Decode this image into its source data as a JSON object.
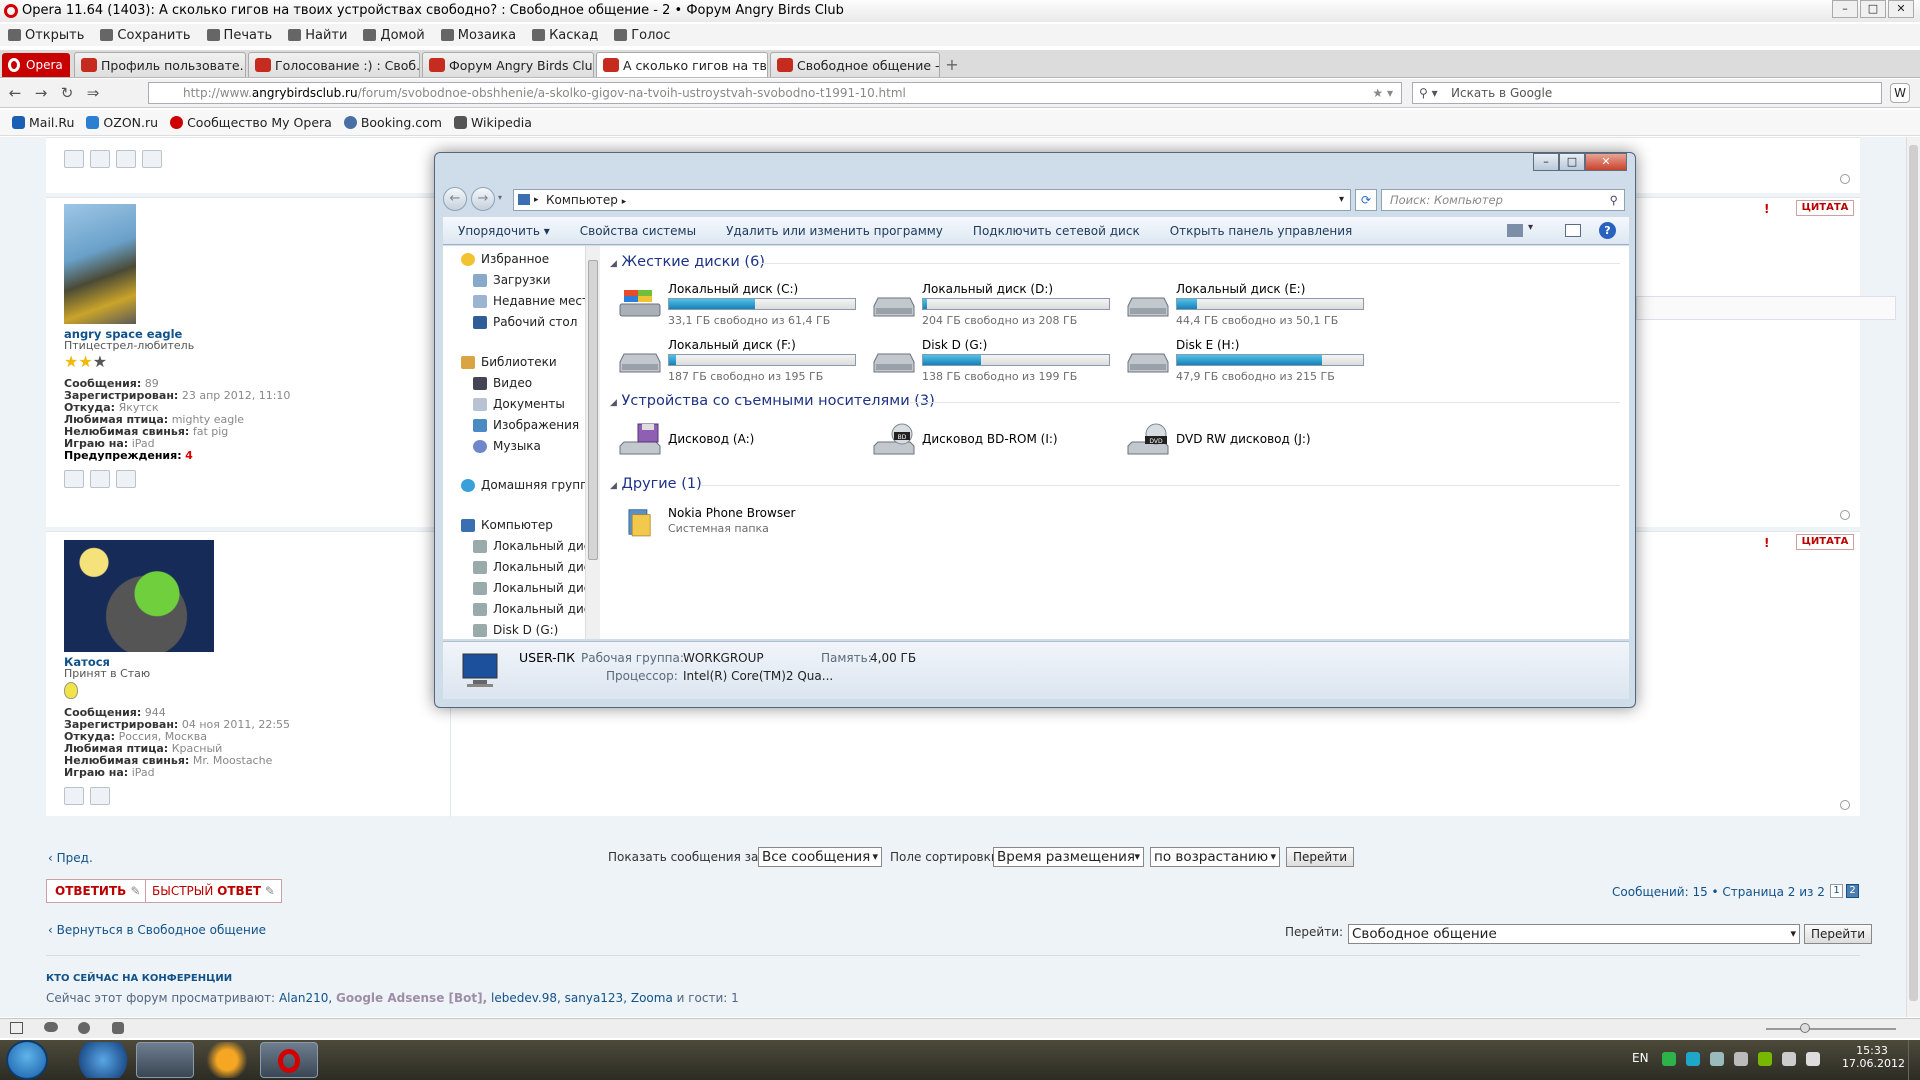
{
  "browser": {
    "title": "Opera 11.64 (1403): А сколько гигов на твоих устройствах свободно? : Свободное общение - 2 • Форум Angry Birds Club",
    "menu": [
      "Открыть",
      "Сохранить",
      "Печать",
      "Найти",
      "Домой",
      "Мозаика",
      "Каскад",
      "Голос"
    ],
    "opera_label": "Opera",
    "tabs": [
      {
        "label": "Профиль пользовате...",
        "active": false
      },
      {
        "label": "Голосование :) : Своб...",
        "active": false
      },
      {
        "label": "Форум Angry Birds Clu...",
        "active": false
      },
      {
        "label": "А сколько гигов на тв...",
        "active": true
      },
      {
        "label": "Свободное общение -...",
        "active": false
      }
    ],
    "address_prefix": "http://www.",
    "address_host": "angrybirdsclub.ru",
    "address_path": "/forum/svobodnoe-obshhenie/a-skolko-gigov-na-tvoih-ustroystvah-svobodno-t1991-10.html",
    "search_placeholder": "Искать в Google",
    "bookmarks": [
      {
        "label": "Mail.Ru",
        "color": "#1a5fb4"
      },
      {
        "label": "OZON.ru",
        "color": "#2a7fd3"
      },
      {
        "label": "Сообщество My Opera",
        "color": "#cc0000"
      },
      {
        "label": "Booking.com",
        "color": "#4a6fa5"
      },
      {
        "label": "Wikipedia",
        "color": "#555555"
      }
    ]
  },
  "forum": {
    "quote_label": "ЦИТАТА",
    "post1": {
      "name": "angry space eagle",
      "rank": "Птицестрел-любитель",
      "fields": [
        {
          "label": "Сообщения:",
          "value": "89"
        },
        {
          "label": "Зарегистрирован:",
          "value": "23 апр 2012, 11:10"
        },
        {
          "label": "Откуда:",
          "value": "Якутск"
        },
        {
          "label": "Любимая птица:",
          "value": "mighty eagle"
        },
        {
          "label": "Нелюбимая свинья:",
          "value": "fat pig"
        },
        {
          "label": "Играю на:",
          "value": "iPad"
        }
      ],
      "warnings_label": "Предупреждения:",
      "warnings_value": "4"
    },
    "post2": {
      "name": "Катося",
      "rank": "Принят в Стаю",
      "fields": [
        {
          "label": "Сообщения:",
          "value": "944"
        },
        {
          "label": "Зарегистрирован:",
          "value": "04 ноя 2011, 22:55"
        },
        {
          "label": "Откуда:",
          "value": "Россия, Москва"
        },
        {
          "label": "Любимая птица:",
          "value": "Красный"
        },
        {
          "label": "Нелюбимая свинья:",
          "value": "Mr. Moostache"
        },
        {
          "label": "Играю на:",
          "value": "iPad"
        }
      ]
    },
    "prev_link": "Пред.",
    "show_label": "Показать сообщения за:",
    "show_value": "Все сообщения",
    "sort_label": "Поле сортировки",
    "sort_value": "Время размещения",
    "order_value": "по возрастанию",
    "go_button": "Перейти",
    "reply_button": "ОТВЕТИТЬ",
    "quick_reply_prefix": "БЫСТРЫЙ ",
    "quick_reply_suffix": "ОТВЕТ",
    "pagination": "Сообщений: 15 • Страница 2 из 2 •",
    "page1": "1",
    "page2": "2",
    "back_link": "Вернуться в Свободное общение",
    "jump_label": "Перейти:",
    "jump_value": "Свободное общение",
    "jump_button": "Перейти",
    "who_title": "КТО СЕЙЧАС НА КОНФЕРЕНЦИИ",
    "who_prefix": "Сейчас этот форум просматривают:",
    "who_users": [
      "Alan210,",
      "Google Adsense [Bot],",
      "lebedev.98,",
      "sanya123,",
      "Zooma"
    ],
    "who_suffix": "и гости: 1"
  },
  "explorer": {
    "breadcrumb": "Компьютер",
    "search_placeholder": "Поиск: Компьютер",
    "toolbar": [
      "Упорядочить ▾",
      "Свойства системы",
      "Удалить или изменить программу",
      "Подключить сетевой диск",
      "Открыть панель управления"
    ],
    "nav": {
      "favorites": "Избранное",
      "fav_items": [
        "Загрузки",
        "Недавние места",
        "Рабочий стол"
      ],
      "libraries": "Библиотеки",
      "lib_items": [
        "Видео",
        "Документы",
        "Изображения",
        "Музыка"
      ],
      "homegroup": "Домашняя группа",
      "computer": "Компьютер",
      "comp_items": [
        "Локальный диск",
        "Локальный диск",
        "Локальный диск",
        "Локальный диск",
        "Disk D (G:)"
      ]
    },
    "groups": {
      "hdd": "Жесткие диски (6)",
      "removable": "Устройства со съемными носителями (3)",
      "other": "Другие (1)"
    },
    "drives": [
      {
        "name": "Локальный диск (C:)",
        "free": "33,1 ГБ свободно из 61,4 ГБ",
        "used_fraction": 0.46
      },
      {
        "name": "Локальный диск (D:)",
        "free": "204 ГБ свободно из 208 ГБ",
        "used_fraction": 0.02
      },
      {
        "name": "Локальный диск (E:)",
        "free": "44,4 ГБ свободно из 50,1 ГБ",
        "used_fraction": 0.11
      },
      {
        "name": "Локальный диск (F:)",
        "free": "187 ГБ свободно из 195 ГБ",
        "used_fraction": 0.04
      },
      {
        "name": "Disk D (G:)",
        "free": "138 ГБ свободно из 199 ГБ",
        "used_fraction": 0.31
      },
      {
        "name": "Disk E (H:)",
        "free": "47,9 ГБ свободно из 215 ГБ",
        "used_fraction": 0.78
      }
    ],
    "removable": [
      "Дисковод (A:)",
      "Дисковод BD-ROM (I:)",
      "DVD RW дисковод (J:)"
    ],
    "bd_badge": "BD",
    "dvd_badge": "DVD",
    "other_name": "Nokia Phone Browser",
    "other_type": "Системная папка",
    "status": {
      "pc": "USER-ПК",
      "workgroup_label": "Рабочая группа:",
      "workgroup": "WORKGROUP",
      "memory_label": "Память:",
      "memory": "4,00 ГБ",
      "cpu_label": "Процессор:",
      "cpu": "Intel(R) Core(TM)2 Qua..."
    }
  },
  "taskbar": {
    "lang": "EN",
    "time": "15:33",
    "date": "17.06.2012"
  }
}
